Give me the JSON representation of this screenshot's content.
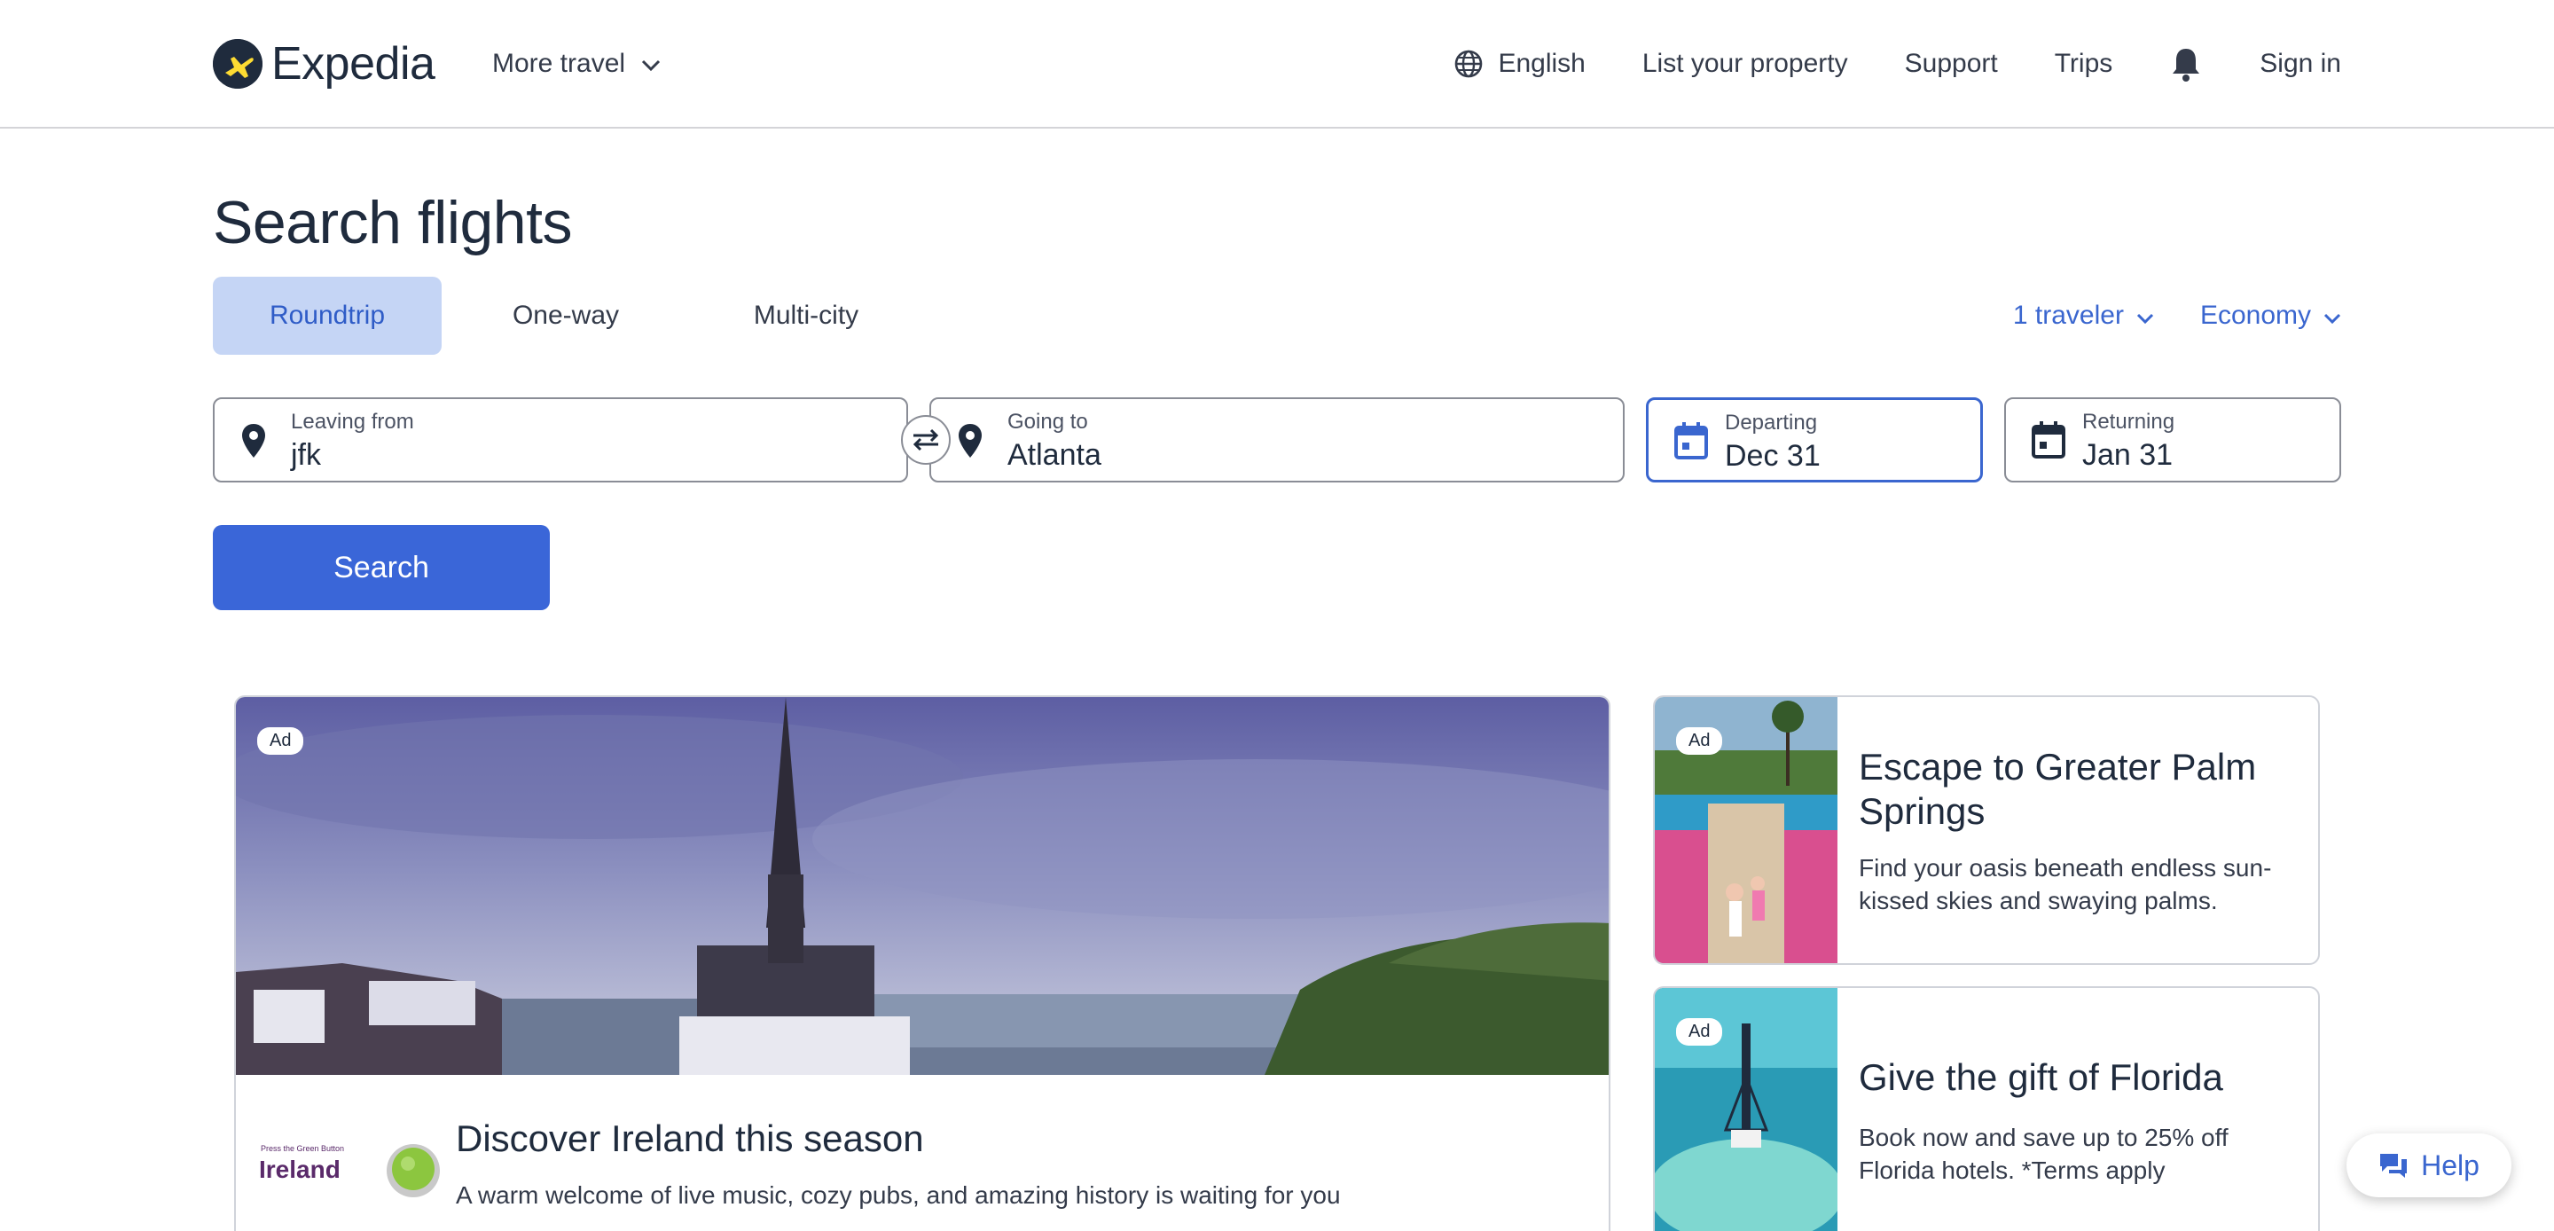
{
  "header": {
    "logo_text": "Expedia",
    "more_travel_label": "More travel",
    "nav": {
      "language_label": "English",
      "list_property_label": "List your property",
      "support_label": "Support",
      "trips_label": "Trips",
      "sign_in_label": "Sign in"
    },
    "icons": [
      "globe-icon",
      "bell-icon",
      "chevron-down-icon"
    ]
  },
  "page": {
    "title": "Search flights"
  },
  "trip_tabs": [
    {
      "label": "Roundtrip",
      "selected": true
    },
    {
      "label": "One-way",
      "selected": false
    },
    {
      "label": "Multi-city",
      "selected": false
    }
  ],
  "travel_options": {
    "travelers_label": "1 traveler",
    "cabin_label": "Economy"
  },
  "search_form": {
    "leaving_from": {
      "label": "Leaving from",
      "value": "jfk",
      "icon": "map-pin-icon"
    },
    "going_to": {
      "label": "Going to",
      "value": "Atlanta",
      "icon": "map-pin-icon"
    },
    "departing": {
      "label": "Departing",
      "value": "Dec 31",
      "icon": "calendar-icon"
    },
    "returning": {
      "label": "Returning",
      "value": "Jan 31",
      "icon": "calendar-icon"
    },
    "search_button_label": "Search"
  },
  "ads": {
    "badge_label": "Ad",
    "featured": {
      "brand_logo_text": "Press the Green Button Ireland",
      "title": "Discover Ireland this season",
      "description": "A warm welcome of live music, cozy pubs, and amazing history is waiting for you"
    },
    "side": [
      {
        "title": "Escape to Greater Palm Springs",
        "description": "Find your oasis beneath endless sun-kissed skies and swaying palms."
      },
      {
        "title": "Give the gift of Florida",
        "description": "Book now and save up to 25% off Florida hotels. *Terms apply"
      }
    ]
  },
  "help": {
    "label": "Help"
  },
  "colors": {
    "accent": "#3a66d8",
    "selected_tab_bg": "#c5d5f5",
    "text_primary": "#1f2b3d",
    "border": "#8a8d96"
  }
}
